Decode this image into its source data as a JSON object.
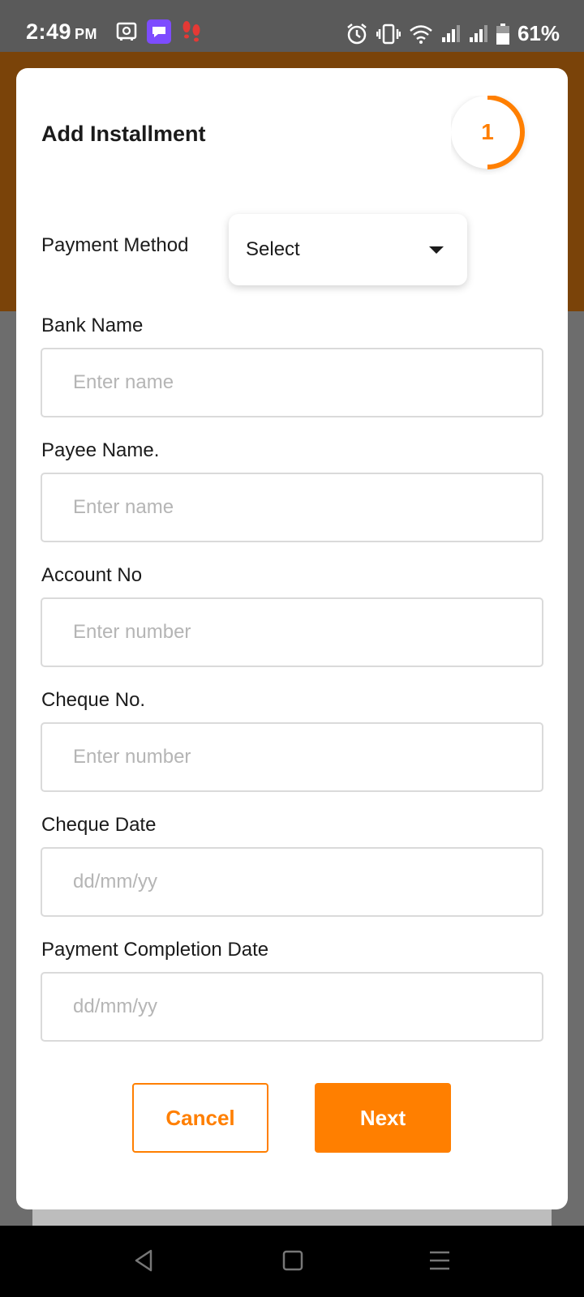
{
  "status_bar": {
    "time": "2:49",
    "ampm": "PM",
    "battery": "61%",
    "icons": [
      "storage-icon",
      "chat-bubble-icon",
      "footsteps-icon",
      "alarm-icon",
      "vibrate-icon",
      "wifi-icon",
      "signal-icon",
      "signal-icon",
      "battery-icon"
    ]
  },
  "form": {
    "title": "Add Installment",
    "step": "1",
    "payment_method": {
      "label": "Payment Method",
      "value": "Select"
    },
    "bank_name": {
      "label": "Bank Name",
      "placeholder": "Enter name"
    },
    "payee_name": {
      "label": "Payee Name.",
      "placeholder": "Enter name"
    },
    "account_no": {
      "label": "Account No",
      "placeholder": "Enter number"
    },
    "cheque_no": {
      "label": "Cheque No.",
      "placeholder": "Enter number"
    },
    "cheque_date": {
      "label": "Cheque Date",
      "placeholder": "dd/mm/yy"
    },
    "completion_date": {
      "label": "Payment Completion Date",
      "placeholder": "dd/mm/yy"
    },
    "cancel_label": "Cancel",
    "next_label": "Next"
  },
  "colors": {
    "accent": "#ff7f00",
    "header_band": "#7a4309"
  },
  "nav": [
    "back-icon",
    "home-icon",
    "menu-icon"
  ]
}
